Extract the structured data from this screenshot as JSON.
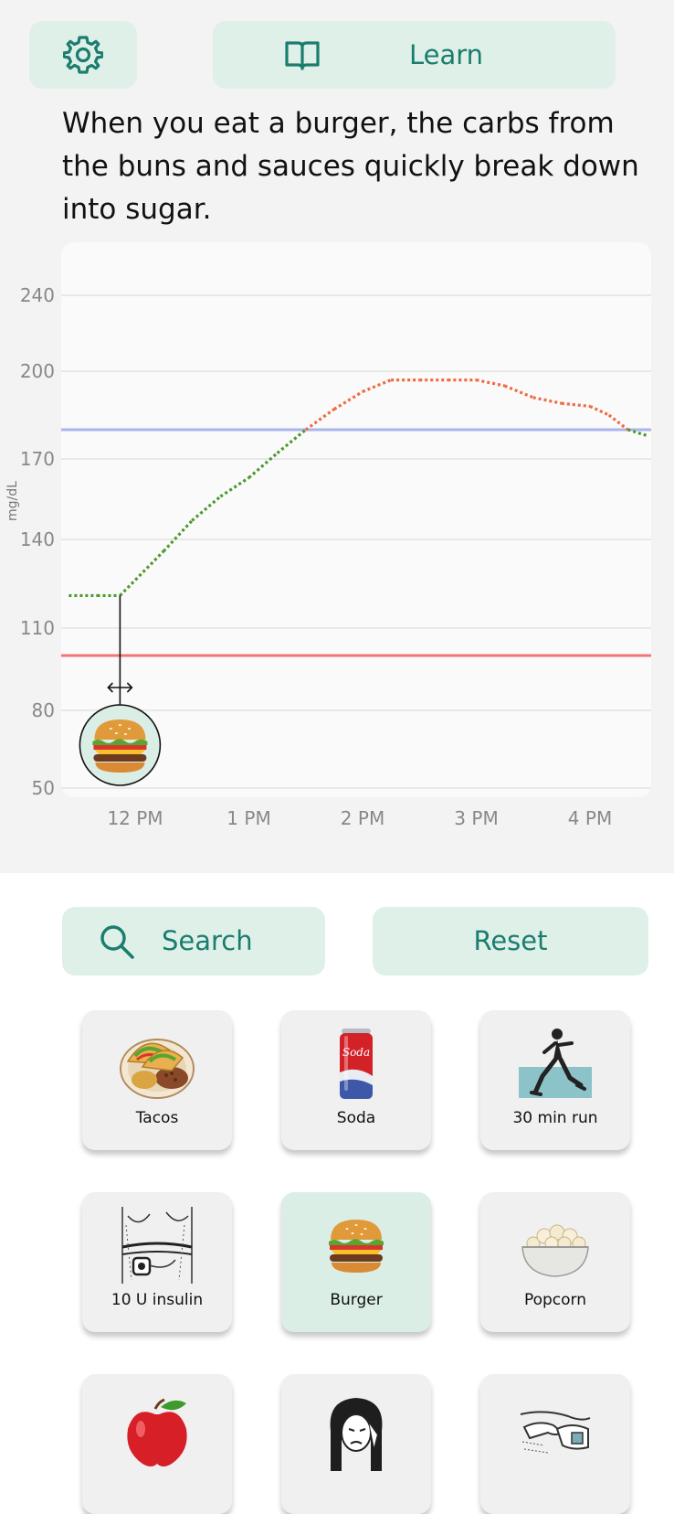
{
  "header": {
    "settings_icon": "gear-icon",
    "learn_icon": "open-book-icon",
    "learn_label": "Learn"
  },
  "explanation": "When you eat a burger, the carbs from the buns and sauces quickly break down into sugar.",
  "colors": {
    "accent": "#1a7d6e",
    "button_bg": "#dff0e8",
    "in_range_line": "#4a9a2c",
    "high_line": "#f06a42",
    "upper_target": "#aab4ee",
    "lower_target": "#f27578"
  },
  "chart_data": {
    "type": "line",
    "ylabel": "mg/dL",
    "y_ticks": [
      "240",
      "200",
      "170",
      "140",
      "110",
      "80",
      "50"
    ],
    "x_ticks": [
      "12 PM",
      "1 PM",
      "2 PM",
      "3 PM",
      "4 PM"
    ],
    "target_high": 180,
    "target_low": 100,
    "grid": true,
    "series": [
      {
        "x": [
          "11:25 AM",
          "11:40 AM",
          "11:52 AM",
          "12:15 PM",
          "12:30 PM",
          "12:45 PM",
          "1:00 PM",
          "1:15 PM",
          "1:30 PM",
          "1:45 PM",
          "2:00 PM",
          "2:15 PM",
          "2:30 PM",
          "2:45 PM",
          "3:00 PM",
          "3:15 PM",
          "3:30 PM",
          "3:45 PM",
          "4:00 PM",
          "4:10 PM",
          "4:20 PM",
          "4:30 PM"
        ],
        "y": [
          121,
          121,
          121,
          136,
          147,
          156,
          163,
          172,
          180,
          187,
          193,
          197,
          197,
          197,
          197,
          195,
          191,
          189,
          188,
          185,
          180,
          178
        ]
      }
    ],
    "event": {
      "label": "Burger",
      "time": "11:52 AM",
      "icon": "burger-icon",
      "drag_icon": "horizontal-double-arrow-icon"
    }
  },
  "controls": {
    "search_icon": "search-icon",
    "search_label": "Search",
    "reset_label": "Reset"
  },
  "tiles": [
    {
      "label": "Tacos",
      "icon": "tacos-icon"
    },
    {
      "label": "Soda",
      "icon": "soda-can-icon"
    },
    {
      "label": "30 min run",
      "icon": "runner-icon"
    },
    {
      "label": "10 U insulin",
      "icon": "insulin-pump-icon"
    },
    {
      "label": "Burger",
      "icon": "burger-icon",
      "selected": true
    },
    {
      "label": "Popcorn",
      "icon": "popcorn-icon"
    },
    {
      "label": "",
      "icon": "apple-icon"
    },
    {
      "label": "",
      "icon": "stressed-woman-icon"
    },
    {
      "label": "",
      "icon": "hands-icon"
    }
  ]
}
